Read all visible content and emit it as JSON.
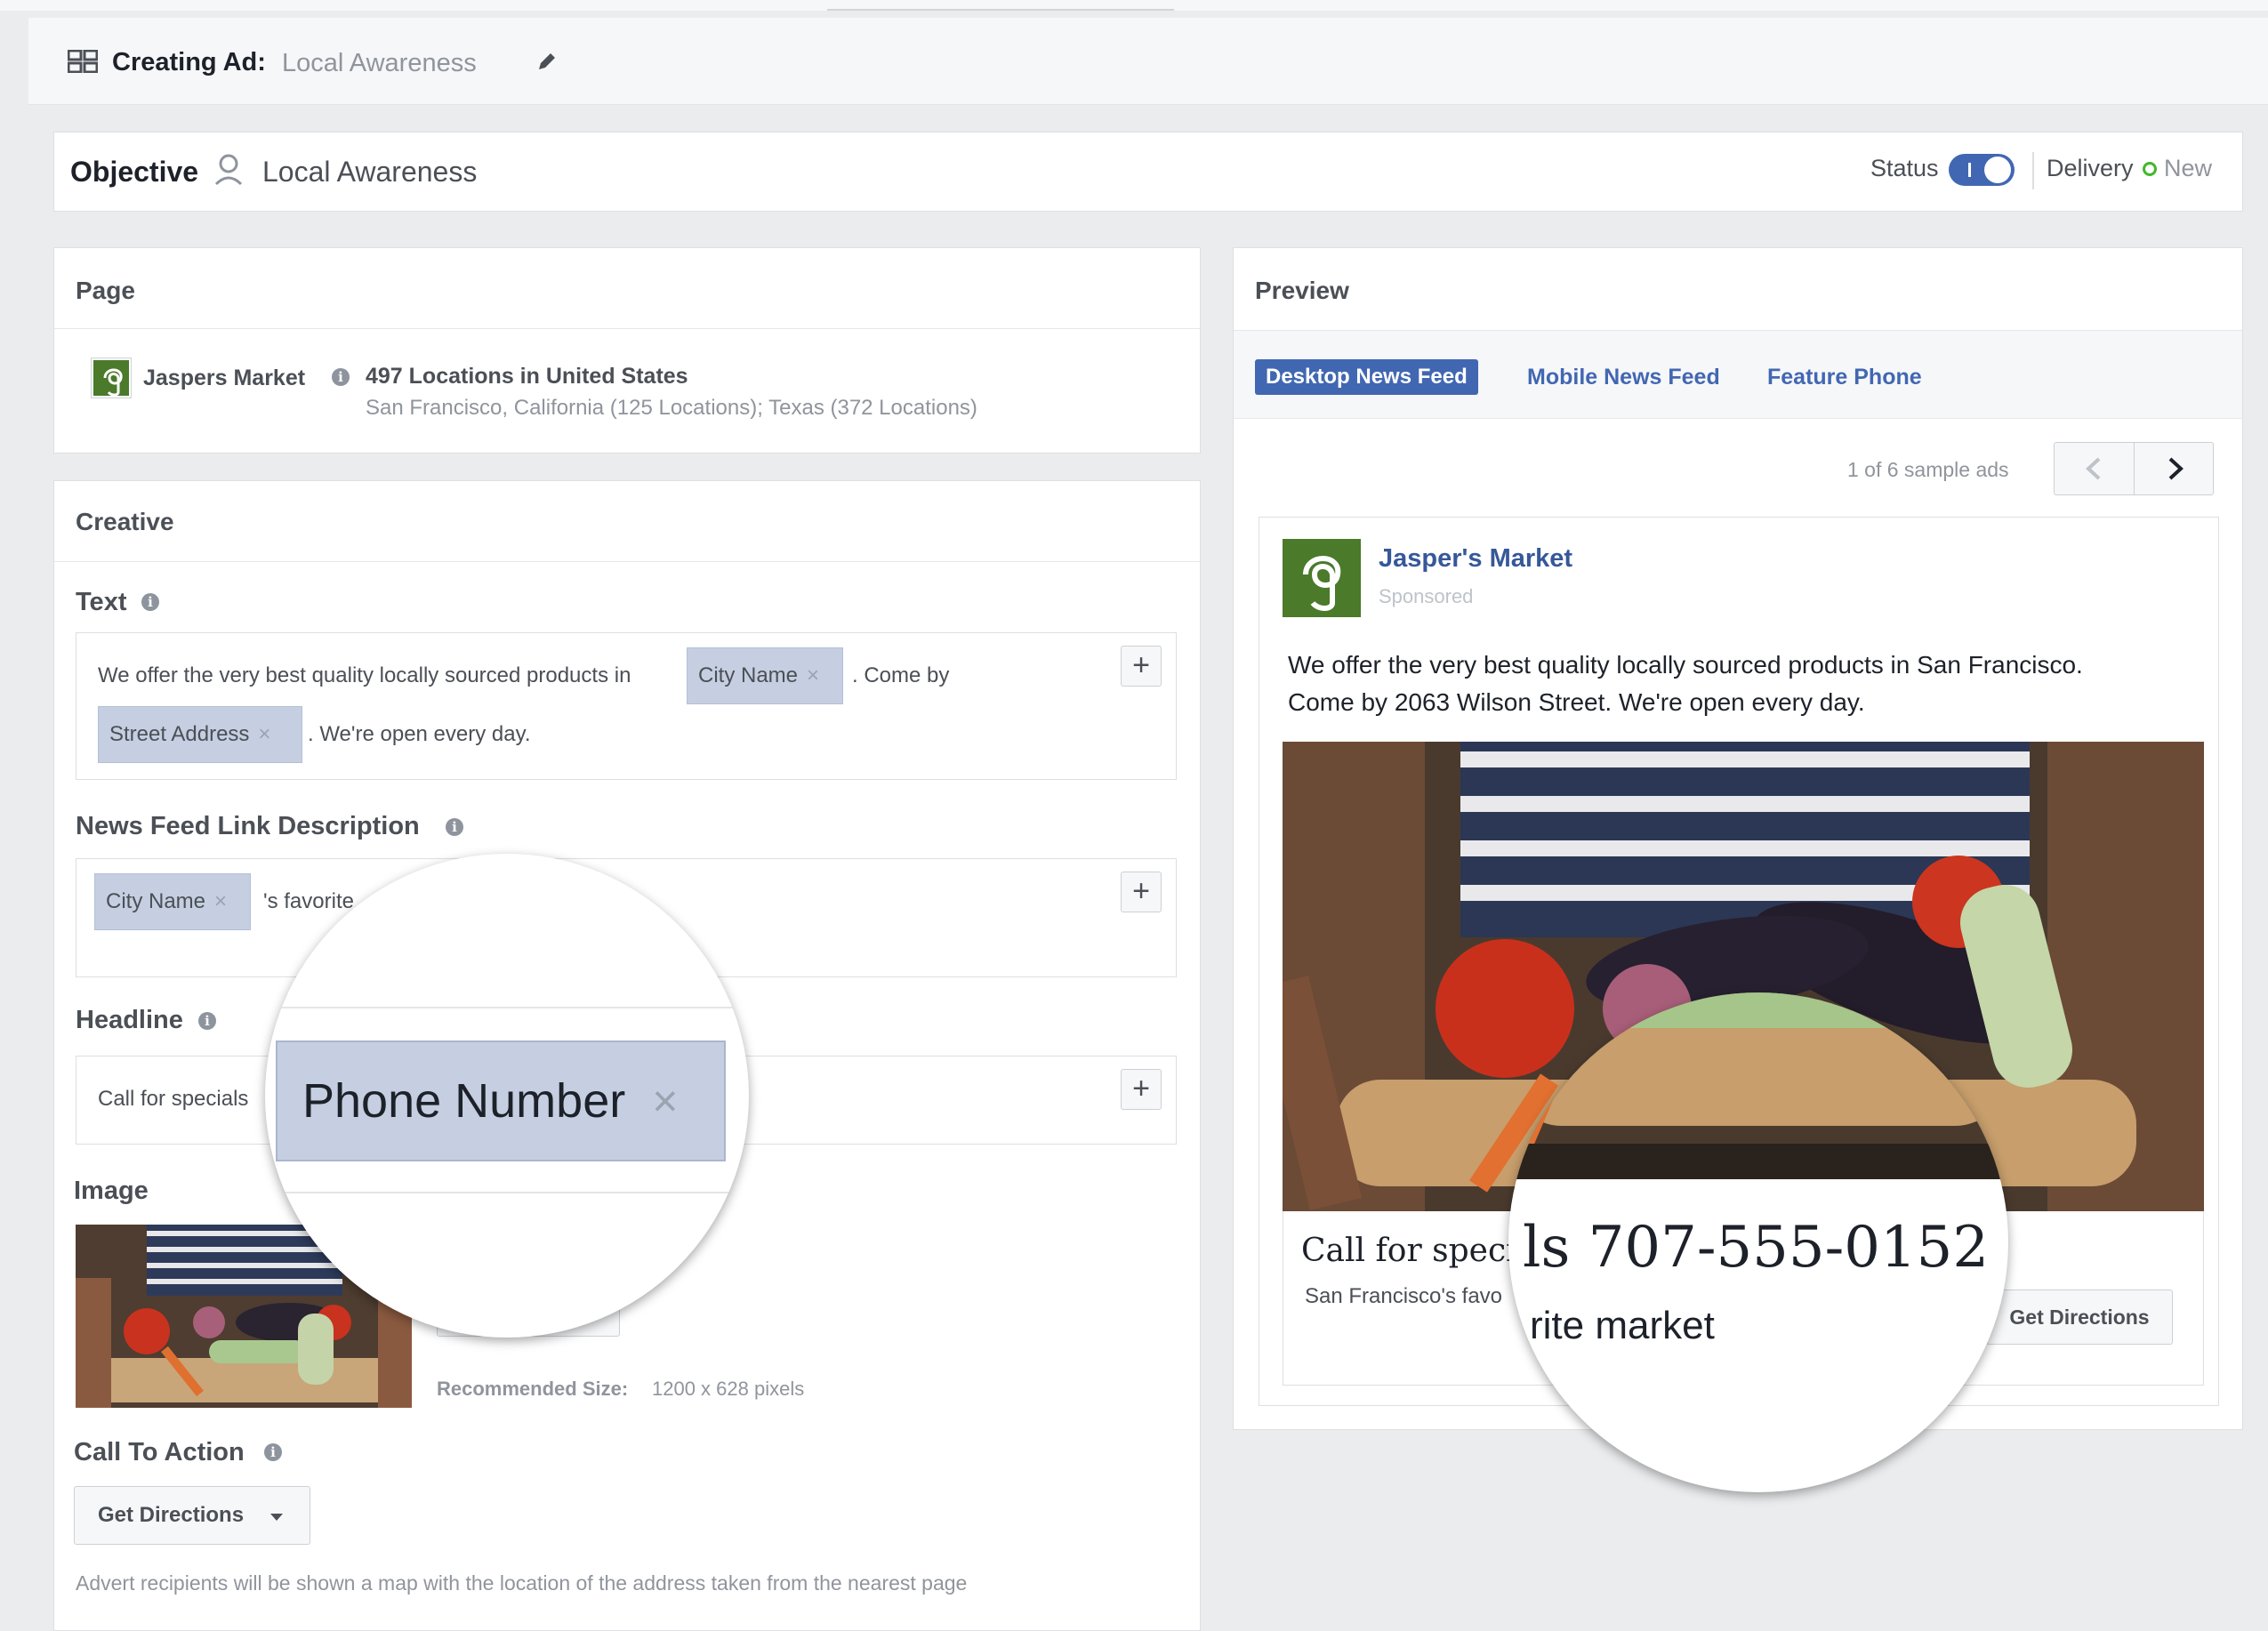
{
  "header": {
    "title_prefix": "Creating Ad:",
    "ad_name": "Local Awareness"
  },
  "objective_bar": {
    "label": "Objective",
    "value": "Local Awareness",
    "status_label": "Status",
    "delivery_label": "Delivery",
    "delivery_value": "New"
  },
  "page_section": {
    "heading": "Page",
    "page_name": "Jaspers Market",
    "locations": "497 Locations in United States",
    "locations_detail": "San Francisco, California (125 Locations); Texas (372 Locations)"
  },
  "creative": {
    "heading": "Creative",
    "text_label": "Text",
    "text_part1": "We offer the very best quality locally sourced products in",
    "text_token1": "City Name",
    "text_part2": ". Come by",
    "text_token2": "Street Address",
    "text_part3": ". We're open every day.",
    "link_desc_label": "News Feed Link Description",
    "link_desc_token": "City Name",
    "link_desc_text": "'s favorite",
    "headline_label": "Headline",
    "headline_text": "Call for specials",
    "magnified_token": "Phone Number",
    "image_label": "Image",
    "recommended_label": "Recommended Size:",
    "recommended_value": "1200 x 628 pixels",
    "cta_label": "Call To Action",
    "cta_value": "Get Directions",
    "footnote": "Advert recipients will be shown a map with the location of the address taken from the nearest page"
  },
  "preview": {
    "heading": "Preview",
    "tabs": [
      "Desktop News Feed",
      "Mobile News Feed",
      "Feature Phone"
    ],
    "sample_counter": "1 of 6 sample ads",
    "advertiser": "Jasper's Market",
    "sponsored": "Sponsored",
    "post_text_line1": "We offer the very best quality locally sourced products in San Francisco.",
    "post_text_line2": "Come by 2063 Wilson Street. We're open every day.",
    "headline_visible": "Call for specia",
    "headline_magnified": "ls 707-555-0152",
    "description_visible": "San Francisco's favo",
    "description_magnified": "rite market",
    "cta_button": "Get Directions"
  },
  "colors": {
    "accent": "#4267b2",
    "brand_green": "#4a7a2a",
    "token_bg": "#c5cfe1",
    "background": "#ebecee"
  }
}
